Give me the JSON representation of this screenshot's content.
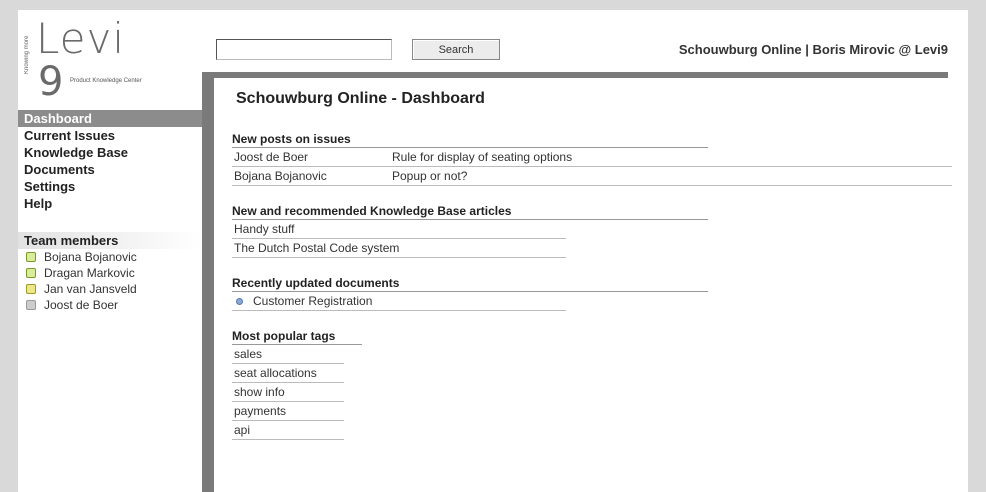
{
  "logo": {
    "brand": "Levi",
    "mark": "9",
    "subtitle": "Product Knowledge Center",
    "side_text": "Knowing more"
  },
  "header": {
    "search_value": "",
    "search_button": "Search",
    "user_info": "Schouwburg Online | Boris Mirovic @ Levi9"
  },
  "sidebar": {
    "nav": [
      {
        "label": "Dashboard",
        "active": true
      },
      {
        "label": "Current Issues"
      },
      {
        "label": "Knowledge Base"
      },
      {
        "label": "Documents"
      },
      {
        "label": "Settings"
      },
      {
        "label": "Help"
      }
    ],
    "team_heading": "Team members",
    "team": [
      {
        "name": "Bojana Bojanovic",
        "status": "online"
      },
      {
        "name": "Dragan Markovic",
        "status": "online"
      },
      {
        "name": "Jan van Jansveld",
        "status": "away"
      },
      {
        "name": "Joost de Boer",
        "status": "offline"
      }
    ]
  },
  "main": {
    "title": "Schouwburg Online - Dashboard",
    "posts": {
      "heading": "New posts on issues",
      "rows": [
        {
          "author": "Joost de Boer",
          "subject": "Rule for display of seating options"
        },
        {
          "author": "Bojana Bojanovic",
          "subject": "Popup or not?"
        }
      ]
    },
    "kb": {
      "heading": "New and recommended Knowledge Base articles",
      "rows": [
        "Handy stuff",
        "The Dutch Postal Code system"
      ]
    },
    "docs": {
      "heading": "Recently updated documents",
      "rows": [
        "Customer Registration"
      ]
    },
    "tags": {
      "heading": "Most popular tags",
      "rows": [
        "sales",
        "seat allocations",
        "show info",
        "payments",
        "api"
      ]
    }
  }
}
